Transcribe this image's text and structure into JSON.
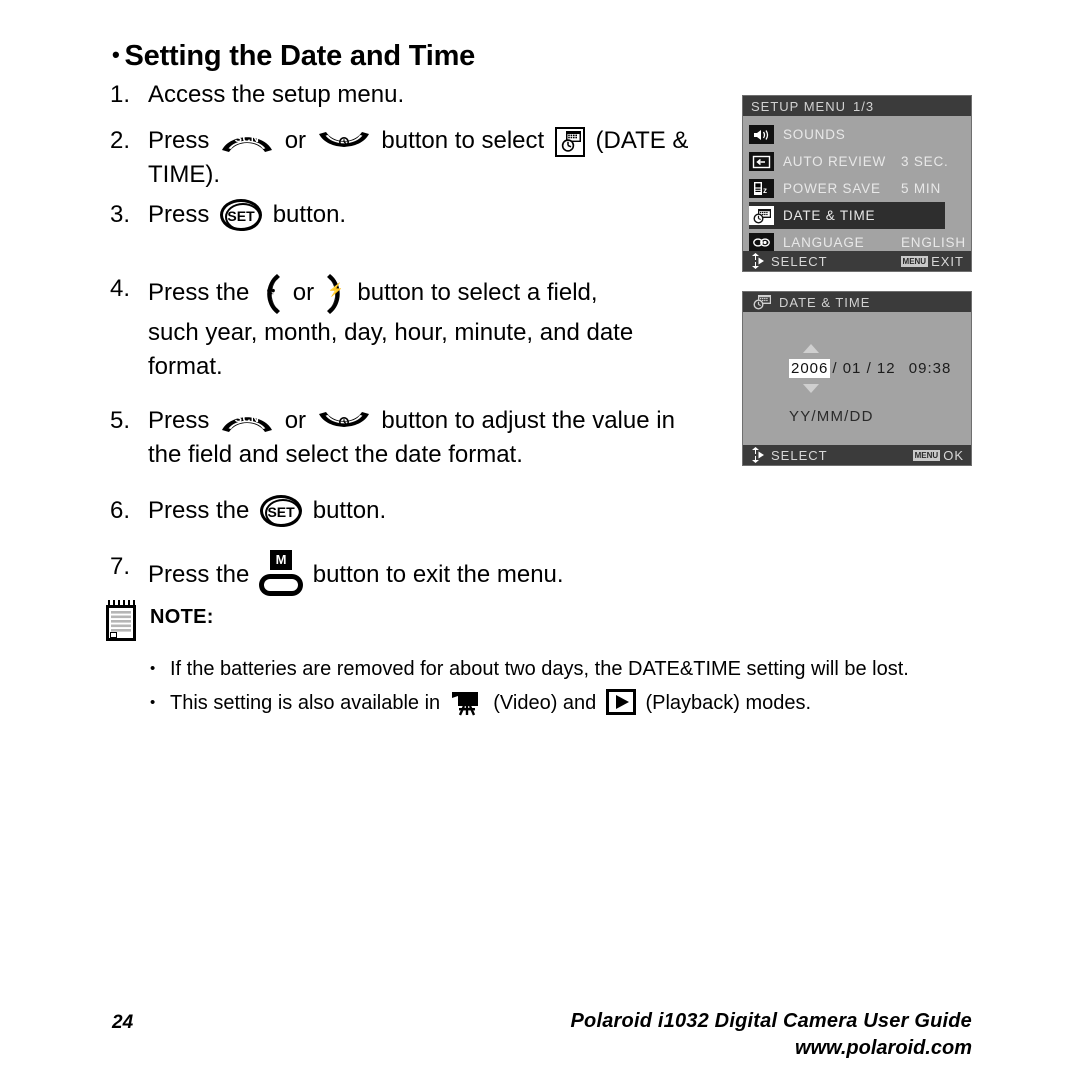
{
  "heading": {
    "bullet": "•",
    "text": "Setting the Date and Time"
  },
  "steps": [
    {
      "num": "1.",
      "pre": "Access the setup menu.",
      "post": ""
    },
    {
      "num": "2.",
      "pre": "Press",
      "mid": "or",
      "mid2": "button to select",
      "post": "(DATE &",
      "line2": "TIME)."
    },
    {
      "num": "3.",
      "pre": "Press",
      "post": "button."
    },
    {
      "num": "4.",
      "pre": "Press the",
      "mid": "or",
      "post": "button to select a field,",
      "line2": "such year, month, day, hour, minute, and date",
      "line3": "format."
    },
    {
      "num": "5.",
      "pre": "Press",
      "mid": "or",
      "post": "button to adjust the value in",
      "line2": "the field and select the date format."
    },
    {
      "num": "6.",
      "pre": "Press the",
      "post": "button."
    },
    {
      "num": "7.",
      "pre": "Press the",
      "post": "button to exit the menu."
    }
  ],
  "buttons": {
    "scn_label": "SCN",
    "selftimer_label": "",
    "set_label": "SET",
    "menu_label": "M"
  },
  "note": {
    "title": "NOTE:",
    "bullet": "•",
    "items": [
      {
        "text": "If the batteries are removed for about two days, the DATE&TIME setting will be lost."
      }
    ],
    "item2": {
      "pre": "This setting is also available in",
      "mid": "(Video) and",
      "post": "(Playback) modes."
    }
  },
  "setup_menu": {
    "title": "SETUP MENU",
    "page": "1/3",
    "rows": [
      {
        "icon": "speaker-icon",
        "label": "SOUNDS",
        "value": "",
        "selected": false
      },
      {
        "icon": "auto-review-icon",
        "label": "AUTO REVIEW",
        "value": "3 SEC.",
        "selected": false
      },
      {
        "icon": "power-save-icon",
        "label": "POWER SAVE",
        "value": "5 MIN",
        "selected": false
      },
      {
        "icon": "date-time-icon",
        "label": "DATE & TIME",
        "value": "",
        "selected": true
      },
      {
        "icon": "language-icon",
        "label": "LANGUAGE",
        "value": "ENGLISH",
        "selected": false
      }
    ],
    "status_left": "SELECT",
    "status_chip": "MENU",
    "status_right": "EXIT"
  },
  "date_time_screen": {
    "title": "DATE & TIME",
    "year": "2006",
    "sep1": "/",
    "month": "01",
    "sep2": "/",
    "day": "12",
    "time": "09:38",
    "format": "YY/MM/DD",
    "status_left": "SELECT",
    "status_chip": "MENU",
    "status_right": "OK"
  },
  "footer": {
    "page_number": "24",
    "guide": "Polaroid i1032 Digital Camera User Guide",
    "url": "www.polaroid.com"
  }
}
